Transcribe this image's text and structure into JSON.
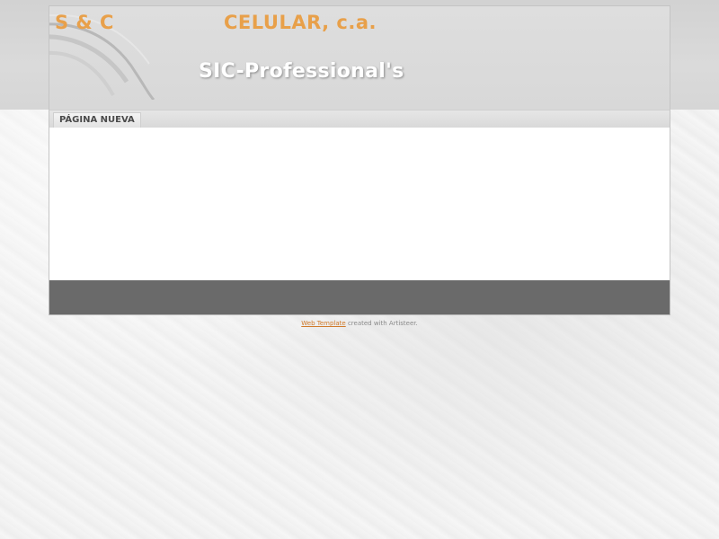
{
  "header": {
    "logo_left": "S & C",
    "logo_right": "CELULAR, c.a.",
    "slogan": "SIC-Professional's"
  },
  "nav": {
    "items": [
      {
        "label": "PÁGINA NUEVA"
      }
    ]
  },
  "footer": {
    "credit_link": "Web Template",
    "credit_text": "created with Artisteer."
  },
  "colors": {
    "logo": "#e8a04a",
    "link": "#d07a2a",
    "footer_bg": "#6a6a6a",
    "content_bg": "#ffffff"
  }
}
